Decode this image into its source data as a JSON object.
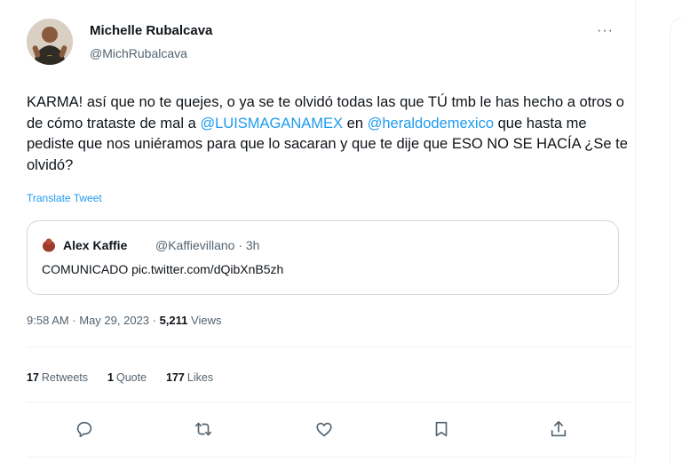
{
  "tweet": {
    "author_name": "Michelle Rubalcava",
    "author_handle": "@MichRubalcava",
    "more_label": "···",
    "text_1": "KARMA! así que no te quejes, o ya se te olvidó todas las que TÚ tmb le has hecho a otros o de cómo trataste de mal a ",
    "mention_1": "@LUISMAGANAMEX",
    "text_2": "  en ",
    "mention_2": "@heraldodemexico",
    "text_3": " que hasta me pediste que nos uniéramos para que lo sacaran y que te dije que ESO NO SE HACÍA ¿Se te olvidó?",
    "translate_label": "Translate Tweet",
    "timestamp": "9:58 AM · May 29, 2023 · ",
    "views_count": "5,211",
    "views_label": " Views"
  },
  "quote": {
    "author_name": "Alex Kaffie",
    "meta": "@Kaffievillano · 3h",
    "text": "COMUNICADO pic.twitter.com/dQibXnB5zh"
  },
  "stats": {
    "retweets_count": "17",
    "retweets_label": "Retweets",
    "quotes_count": "1",
    "quotes_label": "Quote",
    "likes_count": "177",
    "likes_label": "Likes"
  },
  "icons": {
    "reply": "reply-icon",
    "retweet": "retweet-icon",
    "like": "like-icon",
    "bookmark": "bookmark-icon",
    "share": "share-icon"
  },
  "colors": {
    "link": "#1d9bf0",
    "secondary_text": "#536471",
    "border": "#cfd9de"
  }
}
